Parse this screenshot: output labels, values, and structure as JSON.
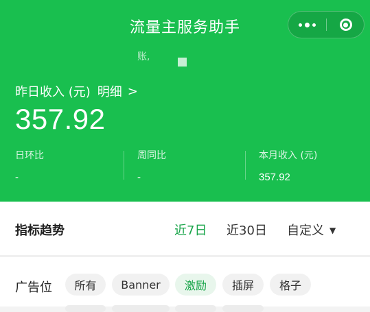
{
  "header": {
    "title": "流量主服务助手",
    "faint_text": "账,",
    "icons": [
      "more-dots-icon",
      "close-circle-icon"
    ],
    "colors": {
      "brand": "#19bf4f",
      "accent": "#19a54a"
    }
  },
  "income": {
    "label": "昨日收入 (元)",
    "detail_link": "明细",
    "detail_chevron": ">",
    "amount": "357.92"
  },
  "stats": [
    {
      "label": "日环比",
      "value": "-"
    },
    {
      "label": "周同比",
      "value": "-"
    },
    {
      "label": "本月收入 (元)",
      "value": "357.92"
    }
  ],
  "trend": {
    "title": "指标趋势",
    "ranges": [
      "近7日",
      "近30日",
      "自定义"
    ],
    "active_range": "近7日",
    "custom_caret": "▼"
  },
  "ad_position": {
    "title": "广告位",
    "chips": [
      "所有",
      "Banner",
      "激励",
      "插屏",
      "格子"
    ],
    "active_chip": "激励"
  }
}
